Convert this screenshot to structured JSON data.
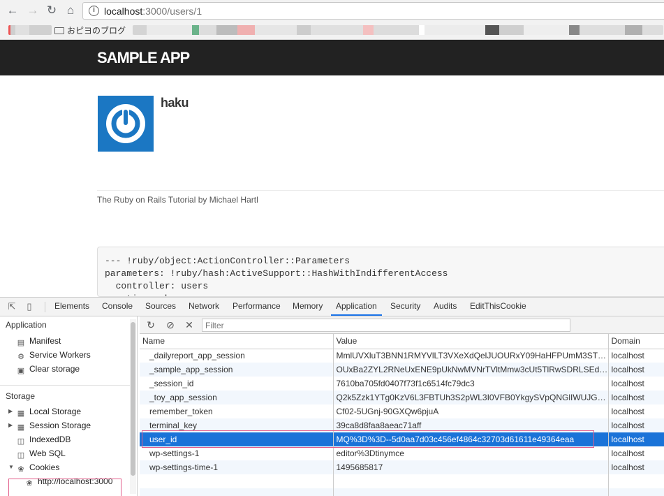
{
  "browser": {
    "url_host": "localhost",
    "url_path": ":3000/users/1",
    "bookmark_label": "おピヨのブログ"
  },
  "app": {
    "logo": "SAMPLE APP",
    "user_name": "haku",
    "footer": "The Ruby on Rails Tutorial by Michael Hartl",
    "debug_lines": "--- !ruby/object:ActionController::Parameters\nparameters: !ruby/hash:ActiveSupport::HashWithIndifferentAccess\n  controller: users\n  action: show"
  },
  "devtools": {
    "tabs": [
      "Elements",
      "Console",
      "Sources",
      "Network",
      "Performance",
      "Memory",
      "Application",
      "Security",
      "Audits",
      "EditThisCookie"
    ],
    "active_tab": "Application",
    "sidebar": {
      "application_heading": "Application",
      "application_items": [
        "Manifest",
        "Service Workers",
        "Clear storage"
      ],
      "storage_heading": "Storage",
      "storage_items": [
        "Local Storage",
        "Session Storage",
        "IndexedDB",
        "Web SQL",
        "Cookies"
      ],
      "cookie_origin": "http://localhost:3000"
    },
    "cookies": {
      "filter_placeholder": "Filter",
      "columns": [
        "Name",
        "Value",
        "Domain"
      ],
      "rows": [
        {
          "name": "_dailyreport_app_session",
          "value": "MmlUVXluT3BNN1RMYVlLT3VXeXdQelJUOURxY09HaHFPUmM3STNT...",
          "domain": "localhost"
        },
        {
          "name": "_sample_app_session",
          "value": "OUxBa2ZYL2RNeUxENE9pUkNwMVNrTVltMmw3cUt5TlRwSDRLSEdw...",
          "domain": "localhost"
        },
        {
          "name": "_session_id",
          "value": "7610ba705fd0407f73f1c6514fc79dc3",
          "domain": "localhost"
        },
        {
          "name": "_toy_app_session",
          "value": "Q2k5Zzk1YTg0KzV6L3FBTUh3S2pWL3I0VFB0YkgySVpQNGlIWUJGL3...",
          "domain": "localhost"
        },
        {
          "name": "remember_token",
          "value": "Cf02-5UGnj-90GXQw6pjuA",
          "domain": "localhost"
        },
        {
          "name": "terminal_key",
          "value": "39ca8d8faa8aeac71aff",
          "domain": "localhost"
        },
        {
          "name": "user_id",
          "value": "MQ%3D%3D--5d0aa7d03c456ef4864c32703d61611e49364eaa",
          "domain": "localhost"
        },
        {
          "name": "wp-settings-1",
          "value": "editor%3Dtinymce",
          "domain": "localhost"
        },
        {
          "name": "wp-settings-time-1",
          "value": "1495685817",
          "domain": "localhost"
        }
      ],
      "selected_row": "user_id"
    }
  },
  "colors": {
    "header_bg": "#222222",
    "avatar_blue": "#1b77c3",
    "selection_blue": "#1a73d8",
    "highlight_pink": "#e25d8a"
  }
}
